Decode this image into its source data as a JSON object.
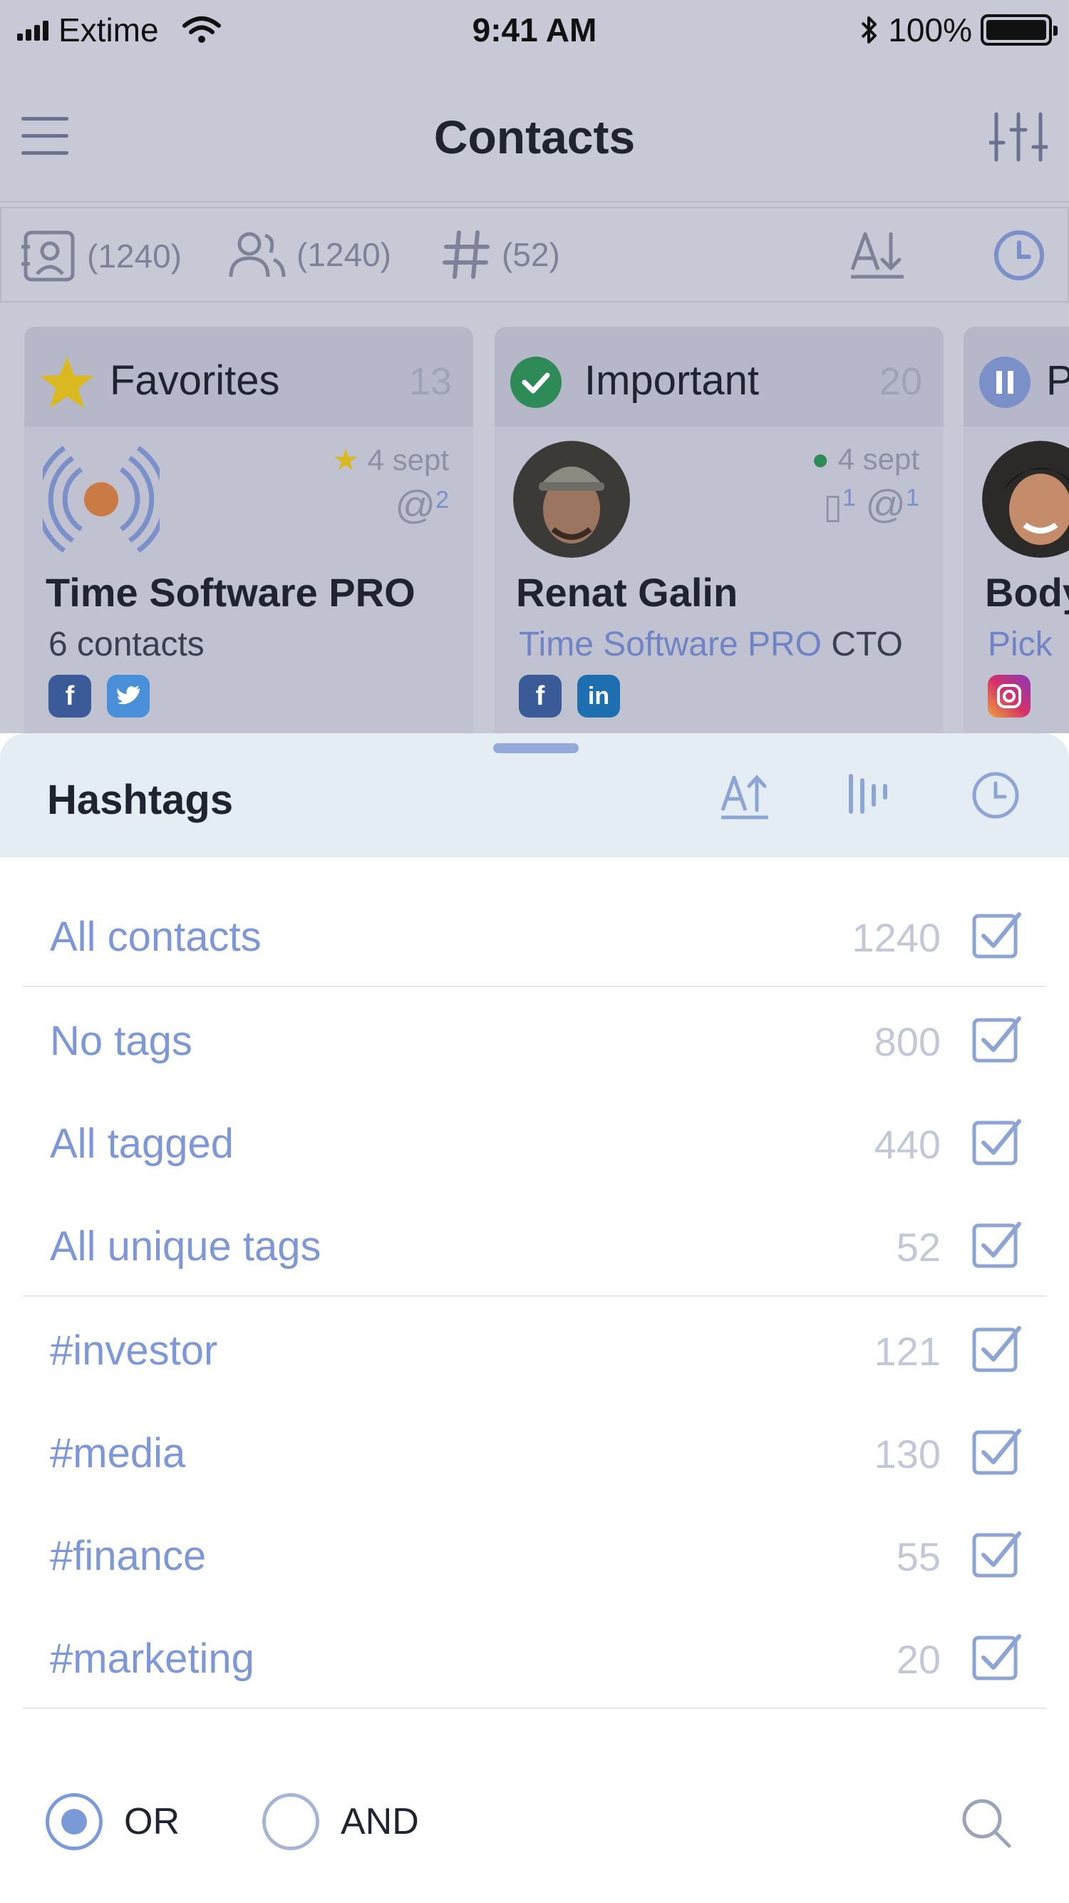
{
  "status_bar": {
    "carrier": "Extime",
    "time": "9:41 AM",
    "battery": "100%"
  },
  "header": {
    "title": "Contacts"
  },
  "stats": {
    "contacts": "(1240)",
    "groups": "(1240)",
    "tags": "(52)"
  },
  "cards": [
    {
      "title": "Favorites",
      "count": "13",
      "name": "Time Software PRO",
      "sub": "6 contacts",
      "date": "4 sept",
      "mentions": "2"
    },
    {
      "title": "Important",
      "count": "20",
      "name": "Renat Galin",
      "company": "Time Software PRO",
      "role": "CTO",
      "date": "4 sept",
      "phones": "1",
      "emails": "1"
    },
    {
      "title": "P",
      "name": "Body",
      "company": "Pick"
    }
  ],
  "sheet": {
    "title": "Hashtags",
    "rows": [
      {
        "label": "All contacts",
        "count": "1240"
      },
      {
        "label": "No tags",
        "count": "800"
      },
      {
        "label": "All tagged",
        "count": "440"
      },
      {
        "label": "All unique tags",
        "count": "52"
      },
      {
        "label": "#investor",
        "count": "121"
      },
      {
        "label": "#media",
        "count": "130"
      },
      {
        "label": "#finance",
        "count": "55"
      },
      {
        "label": "#marketing",
        "count": "20"
      }
    ],
    "mode_or": "OR",
    "mode_and": "AND"
  },
  "colors": {
    "accent": "#7e97d6",
    "dim_bg": "#c8c9d7",
    "sheet_head": "#e4ecf4"
  }
}
